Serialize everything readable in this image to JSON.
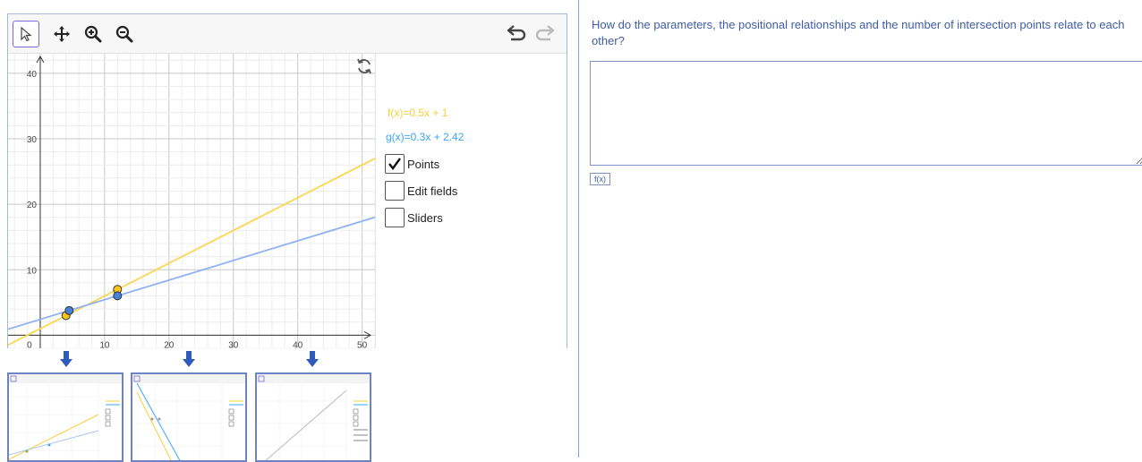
{
  "toolbar": {
    "tools": [
      {
        "icon": "cursor-icon",
        "selected": true
      },
      {
        "icon": "move-icon",
        "selected": false
      },
      {
        "icon": "zoom-in-icon",
        "selected": false
      },
      {
        "icon": "zoom-out-icon",
        "selected": false
      }
    ],
    "undo_icon": "undo-icon",
    "redo_icon": "redo-icon"
  },
  "graph": {
    "x_ticks": [
      "0",
      "10",
      "20",
      "30",
      "40",
      "50"
    ],
    "y_ticks": [
      "10",
      "20",
      "30",
      "40"
    ],
    "refresh_icon": "refresh-icon"
  },
  "chart_data": {
    "type": "line",
    "xlim": [
      -5,
      52
    ],
    "ylim": [
      -2,
      43
    ],
    "grid": true,
    "series": [
      {
        "name": "f(x)=0.5x + 1",
        "slope": 0.5,
        "intercept": 1,
        "color": "#f5d13a",
        "points": [
          [
            4,
            3
          ],
          [
            12,
            7
          ]
        ]
      },
      {
        "name": "g(x)=0.3x + 2.42",
        "slope": 0.3,
        "intercept": 2.42,
        "color": "#3ba5f4",
        "points": [
          [
            4.5,
            3.77
          ],
          [
            12,
            6.02
          ]
        ]
      }
    ]
  },
  "algebra": {
    "f_label": "f(x)=0.5x + 1",
    "g_label": "g(x)=0.3x + 2.42",
    "checkboxes": [
      {
        "label": "Points",
        "checked": true
      },
      {
        "label": "Edit fields",
        "checked": false
      },
      {
        "label": "Sliders",
        "checked": false
      }
    ]
  },
  "question": "How do the parameters, the positional relationships and the number of intersection points relate to each other?",
  "answer": {
    "value": ""
  },
  "fx_button": "f(x)"
}
